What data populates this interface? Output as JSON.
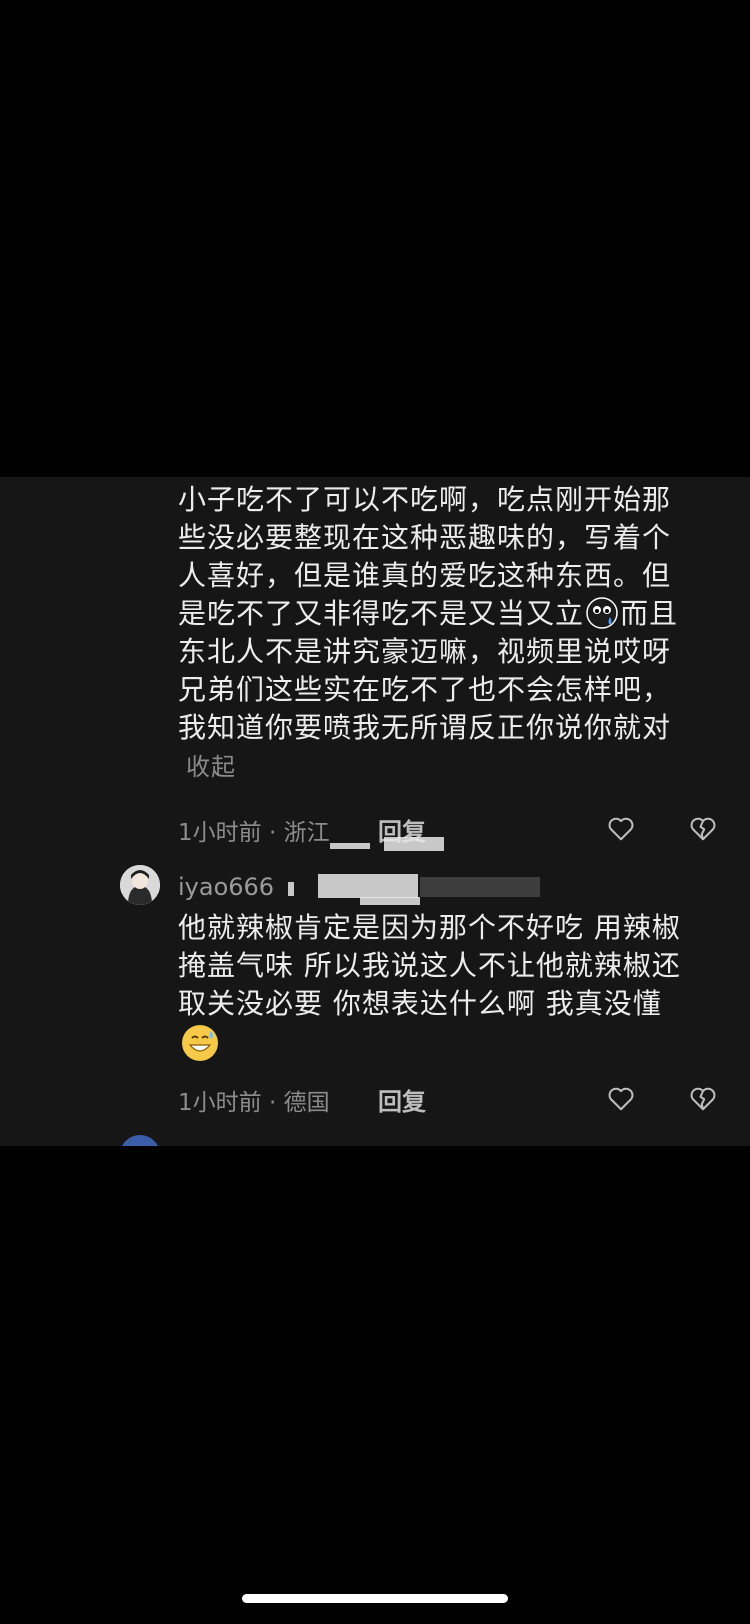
{
  "comment1": {
    "lines": [
      "小子吃不了可以不吃啊，吃点刚开始那",
      "些没必要整现在这种恶趣味的，写着个",
      "人喜好，但是谁真的爱吃这种东西。但",
      "是吃不了又非得吃不是又当又立",
      "而且",
      "东北人不是讲究豪迈嘛，视频里说哎呀",
      "兄弟们这些实在吃不了也不会怎样吧，",
      "我知道你要喷我无所谓反正你说你就对"
    ],
    "collapse_label": "收起",
    "meta": "1小时前 · 浙江",
    "reply_label": "回复"
  },
  "comment2": {
    "username": "iyao666",
    "lines": [
      "他就辣椒肯定是因为那个不好吃 用辣椒",
      "掩盖气味 所以我说这人不让他就辣椒还",
      "取关没必要 你想表达什么啊 我真没懂"
    ],
    "meta": "1小时前 · 德国",
    "reply_label": "回复"
  },
  "icons": {
    "like": "heart-outline-icon",
    "dislike": "broken-heart-icon",
    "emoji1": "crying-face-emoji",
    "emoji2": "grinning-sweat-emoji"
  },
  "colors": {
    "background": "#000000",
    "panel": "#161616",
    "text": "#ececec",
    "meta": "#8c8c8c"
  }
}
